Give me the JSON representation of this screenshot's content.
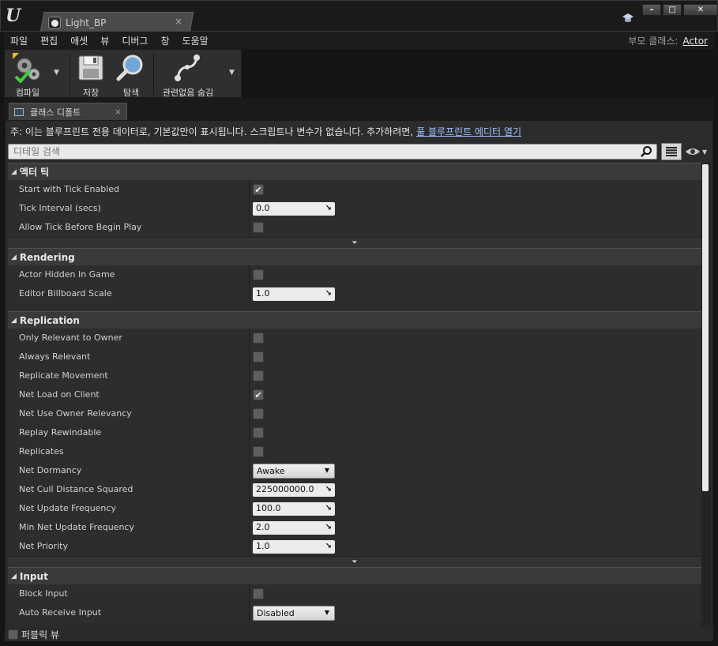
{
  "window": {
    "tab_title": "Light_BP",
    "close_glyph": "×",
    "controls": {
      "minimize": "–",
      "maximize": "□",
      "close": "✕"
    }
  },
  "menu": {
    "items": [
      "파일",
      "편집",
      "애셋",
      "뷰",
      "디버그",
      "창",
      "도움말"
    ],
    "parent_class_label": "부모 클래스:",
    "parent_class_value": "Actor"
  },
  "toolbar": {
    "compile": "컴파일",
    "save": "저장",
    "browse": "탐색",
    "hide_unrelated": "관련없음 숨김"
  },
  "panel_tab": {
    "label": "클래스 디폴트",
    "close_glyph": "×"
  },
  "notice": {
    "text": "주: 이는 블루프린트 전용 데이터로, 기본값만이 표시됩니다. 스크립트나 변수가 없습니다. 추가하려면,",
    "link": "풀 블루프린트 에디터 열기"
  },
  "search": {
    "placeholder": "디테일 검색"
  },
  "categories": [
    {
      "title": "액터 틱",
      "props": [
        {
          "name": "Start with Tick Enabled",
          "type": "check",
          "checked": true
        },
        {
          "name": "Tick Interval (secs)",
          "type": "number",
          "value": "0.0"
        },
        {
          "name": "Allow Tick Before Begin Play",
          "type": "check",
          "checked": false
        }
      ],
      "advanced": true
    },
    {
      "title": "Rendering",
      "props": [
        {
          "name": "Actor Hidden In Game",
          "type": "check",
          "checked": false
        },
        {
          "name": "Editor Billboard Scale",
          "type": "number",
          "value": "1.0"
        }
      ],
      "advanced": false
    },
    {
      "title": "Replication",
      "props": [
        {
          "name": "Only Relevant to Owner",
          "type": "check",
          "checked": false
        },
        {
          "name": "Always Relevant",
          "type": "check",
          "checked": false
        },
        {
          "name": "Replicate Movement",
          "type": "check",
          "checked": false
        },
        {
          "name": "Net Load on Client",
          "type": "check",
          "checked": true
        },
        {
          "name": "Net Use Owner Relevancy",
          "type": "check",
          "checked": false
        },
        {
          "name": "Replay Rewindable",
          "type": "check",
          "checked": false
        },
        {
          "name": "Replicates",
          "type": "check",
          "checked": false
        },
        {
          "name": "Net Dormancy",
          "type": "combo",
          "value": "Awake"
        },
        {
          "name": "Net Cull Distance Squared",
          "type": "number",
          "value": "225000000.0"
        },
        {
          "name": "Net Update Frequency",
          "type": "number",
          "value": "100.0"
        },
        {
          "name": "Min Net Update Frequency",
          "type": "number",
          "value": "2.0"
        },
        {
          "name": "Net Priority",
          "type": "number",
          "value": "1.0"
        }
      ],
      "advanced": true
    },
    {
      "title": "Input",
      "props": [
        {
          "name": "Block Input",
          "type": "check",
          "checked": false
        },
        {
          "name": "Auto Receive Input",
          "type": "combo",
          "value": "Disabled"
        }
      ],
      "advanced": false
    }
  ],
  "footer": {
    "label": "퍼블릭 뷰"
  },
  "glyphs": {
    "check": "✔",
    "drag": "↘",
    "dropdown": "▼",
    "collapse": "◢",
    "advanced": "⏷"
  }
}
